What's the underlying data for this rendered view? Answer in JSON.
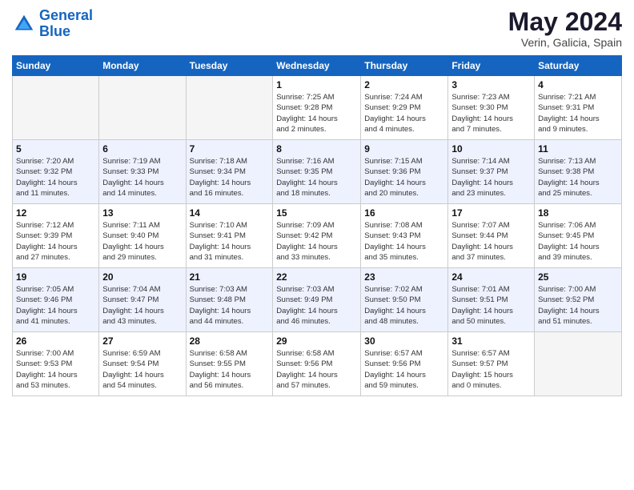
{
  "header": {
    "logo_line1": "General",
    "logo_line2": "Blue",
    "title": "May 2024",
    "subtitle": "Verin, Galicia, Spain"
  },
  "weekdays": [
    "Sunday",
    "Monday",
    "Tuesday",
    "Wednesday",
    "Thursday",
    "Friday",
    "Saturday"
  ],
  "weeks": [
    [
      {
        "day": "",
        "info": ""
      },
      {
        "day": "",
        "info": ""
      },
      {
        "day": "",
        "info": ""
      },
      {
        "day": "1",
        "info": "Sunrise: 7:25 AM\nSunset: 9:28 PM\nDaylight: 14 hours\nand 2 minutes."
      },
      {
        "day": "2",
        "info": "Sunrise: 7:24 AM\nSunset: 9:29 PM\nDaylight: 14 hours\nand 4 minutes."
      },
      {
        "day": "3",
        "info": "Sunrise: 7:23 AM\nSunset: 9:30 PM\nDaylight: 14 hours\nand 7 minutes."
      },
      {
        "day": "4",
        "info": "Sunrise: 7:21 AM\nSunset: 9:31 PM\nDaylight: 14 hours\nand 9 minutes."
      }
    ],
    [
      {
        "day": "5",
        "info": "Sunrise: 7:20 AM\nSunset: 9:32 PM\nDaylight: 14 hours\nand 11 minutes."
      },
      {
        "day": "6",
        "info": "Sunrise: 7:19 AM\nSunset: 9:33 PM\nDaylight: 14 hours\nand 14 minutes."
      },
      {
        "day": "7",
        "info": "Sunrise: 7:18 AM\nSunset: 9:34 PM\nDaylight: 14 hours\nand 16 minutes."
      },
      {
        "day": "8",
        "info": "Sunrise: 7:16 AM\nSunset: 9:35 PM\nDaylight: 14 hours\nand 18 minutes."
      },
      {
        "day": "9",
        "info": "Sunrise: 7:15 AM\nSunset: 9:36 PM\nDaylight: 14 hours\nand 20 minutes."
      },
      {
        "day": "10",
        "info": "Sunrise: 7:14 AM\nSunset: 9:37 PM\nDaylight: 14 hours\nand 23 minutes."
      },
      {
        "day": "11",
        "info": "Sunrise: 7:13 AM\nSunset: 9:38 PM\nDaylight: 14 hours\nand 25 minutes."
      }
    ],
    [
      {
        "day": "12",
        "info": "Sunrise: 7:12 AM\nSunset: 9:39 PM\nDaylight: 14 hours\nand 27 minutes."
      },
      {
        "day": "13",
        "info": "Sunrise: 7:11 AM\nSunset: 9:40 PM\nDaylight: 14 hours\nand 29 minutes."
      },
      {
        "day": "14",
        "info": "Sunrise: 7:10 AM\nSunset: 9:41 PM\nDaylight: 14 hours\nand 31 minutes."
      },
      {
        "day": "15",
        "info": "Sunrise: 7:09 AM\nSunset: 9:42 PM\nDaylight: 14 hours\nand 33 minutes."
      },
      {
        "day": "16",
        "info": "Sunrise: 7:08 AM\nSunset: 9:43 PM\nDaylight: 14 hours\nand 35 minutes."
      },
      {
        "day": "17",
        "info": "Sunrise: 7:07 AM\nSunset: 9:44 PM\nDaylight: 14 hours\nand 37 minutes."
      },
      {
        "day": "18",
        "info": "Sunrise: 7:06 AM\nSunset: 9:45 PM\nDaylight: 14 hours\nand 39 minutes."
      }
    ],
    [
      {
        "day": "19",
        "info": "Sunrise: 7:05 AM\nSunset: 9:46 PM\nDaylight: 14 hours\nand 41 minutes."
      },
      {
        "day": "20",
        "info": "Sunrise: 7:04 AM\nSunset: 9:47 PM\nDaylight: 14 hours\nand 43 minutes."
      },
      {
        "day": "21",
        "info": "Sunrise: 7:03 AM\nSunset: 9:48 PM\nDaylight: 14 hours\nand 44 minutes."
      },
      {
        "day": "22",
        "info": "Sunrise: 7:03 AM\nSunset: 9:49 PM\nDaylight: 14 hours\nand 46 minutes."
      },
      {
        "day": "23",
        "info": "Sunrise: 7:02 AM\nSunset: 9:50 PM\nDaylight: 14 hours\nand 48 minutes."
      },
      {
        "day": "24",
        "info": "Sunrise: 7:01 AM\nSunset: 9:51 PM\nDaylight: 14 hours\nand 50 minutes."
      },
      {
        "day": "25",
        "info": "Sunrise: 7:00 AM\nSunset: 9:52 PM\nDaylight: 14 hours\nand 51 minutes."
      }
    ],
    [
      {
        "day": "26",
        "info": "Sunrise: 7:00 AM\nSunset: 9:53 PM\nDaylight: 14 hours\nand 53 minutes."
      },
      {
        "day": "27",
        "info": "Sunrise: 6:59 AM\nSunset: 9:54 PM\nDaylight: 14 hours\nand 54 minutes."
      },
      {
        "day": "28",
        "info": "Sunrise: 6:58 AM\nSunset: 9:55 PM\nDaylight: 14 hours\nand 56 minutes."
      },
      {
        "day": "29",
        "info": "Sunrise: 6:58 AM\nSunset: 9:56 PM\nDaylight: 14 hours\nand 57 minutes."
      },
      {
        "day": "30",
        "info": "Sunrise: 6:57 AM\nSunset: 9:56 PM\nDaylight: 14 hours\nand 59 minutes."
      },
      {
        "day": "31",
        "info": "Sunrise: 6:57 AM\nSunset: 9:57 PM\nDaylight: 15 hours\nand 0 minutes."
      },
      {
        "day": "",
        "info": ""
      }
    ]
  ]
}
